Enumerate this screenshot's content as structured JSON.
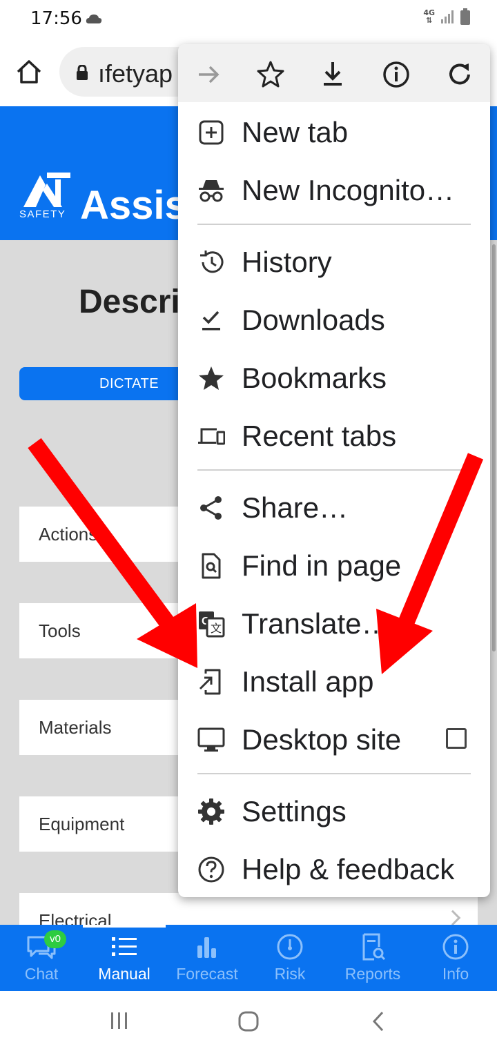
{
  "status_bar": {
    "time": "17:56",
    "network": "4G"
  },
  "address_bar": {
    "url_text": "ıfetyap"
  },
  "page": {
    "logo_text": "SAFETY",
    "app_title": "Assis",
    "heading": "Descri",
    "dictate_label": "DICTATE",
    "categories": [
      "Actions",
      "Tools",
      "Materials",
      "Equipment",
      "Electrical"
    ]
  },
  "menu": {
    "items": [
      {
        "label": "New tab",
        "icon": "plus-box-icon"
      },
      {
        "label": "New Incognito…",
        "icon": "incognito-icon"
      },
      {
        "label": "History",
        "icon": "history-icon"
      },
      {
        "label": "Downloads",
        "icon": "download-check-icon"
      },
      {
        "label": "Bookmarks",
        "icon": "star-icon"
      },
      {
        "label": "Recent tabs",
        "icon": "devices-icon"
      },
      {
        "label": "Share…",
        "icon": "share-icon"
      },
      {
        "label": "Find in page",
        "icon": "find-in-page-icon"
      },
      {
        "label": "Translate…",
        "icon": "translate-icon"
      },
      {
        "label": "Install app",
        "icon": "install-app-icon"
      },
      {
        "label": "Desktop site",
        "icon": "monitor-icon"
      },
      {
        "label": "Settings",
        "icon": "gear-icon"
      },
      {
        "label": "Help & feedback",
        "icon": "help-icon"
      }
    ]
  },
  "bottom_nav": {
    "badge": "v0",
    "items": [
      {
        "label": "Chat",
        "icon": "chat-icon"
      },
      {
        "label": "Manual",
        "icon": "list-icon"
      },
      {
        "label": "Forecast",
        "icon": "bar-chart-icon"
      },
      {
        "label": "Risk",
        "icon": "gauge-icon"
      },
      {
        "label": "Reports",
        "icon": "report-search-icon"
      },
      {
        "label": "Info",
        "icon": "info-icon"
      }
    ],
    "active_index": 1
  },
  "colors": {
    "brand_blue": "#0a73f0",
    "arrow_red": "#ff0000"
  }
}
